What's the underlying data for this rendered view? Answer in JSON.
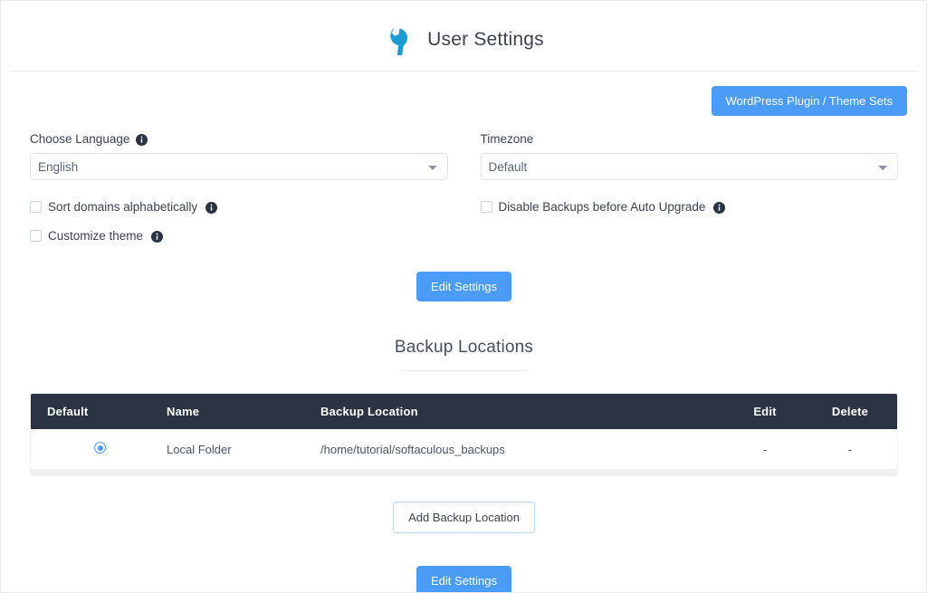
{
  "header": {
    "title": "User Settings",
    "icon": "wrench-icon"
  },
  "toolbar": {
    "wordpress_sets_label": "WordPress Plugin / Theme Sets"
  },
  "form": {
    "language": {
      "label": "Choose Language",
      "info_icon": "info-icon",
      "value": "English",
      "options": [
        "English"
      ]
    },
    "timezone": {
      "label": "Timezone",
      "value": "Default",
      "options": [
        "Default"
      ]
    },
    "checkboxes": [
      {
        "label": "Sort domains alphabetically",
        "checked": false,
        "info_icon": "info-icon"
      },
      {
        "label": "Customize theme",
        "checked": false,
        "info_icon": "info-icon"
      },
      {
        "label": "Disable Backups before Auto Upgrade",
        "checked": false,
        "info_icon": "info-icon"
      }
    ],
    "edit_settings_label": "Edit Settings"
  },
  "backup_section": {
    "heading": "Backup Locations",
    "columns": [
      "Default",
      "Name",
      "Backup Location",
      "Edit",
      "Delete"
    ],
    "rows": [
      {
        "default_selected": true,
        "name": "Local Folder",
        "location": "/home/tutorial/softaculous_backups",
        "edit": "-",
        "delete": "-"
      }
    ],
    "add_location_label": "Add Backup Location",
    "edit_settings_label": "Edit Settings"
  },
  "colors": {
    "primary": "#4a9cf6",
    "header_dark": "#2b3443",
    "icon_blue": "#1b9bd1",
    "text": "#3b4350"
  }
}
